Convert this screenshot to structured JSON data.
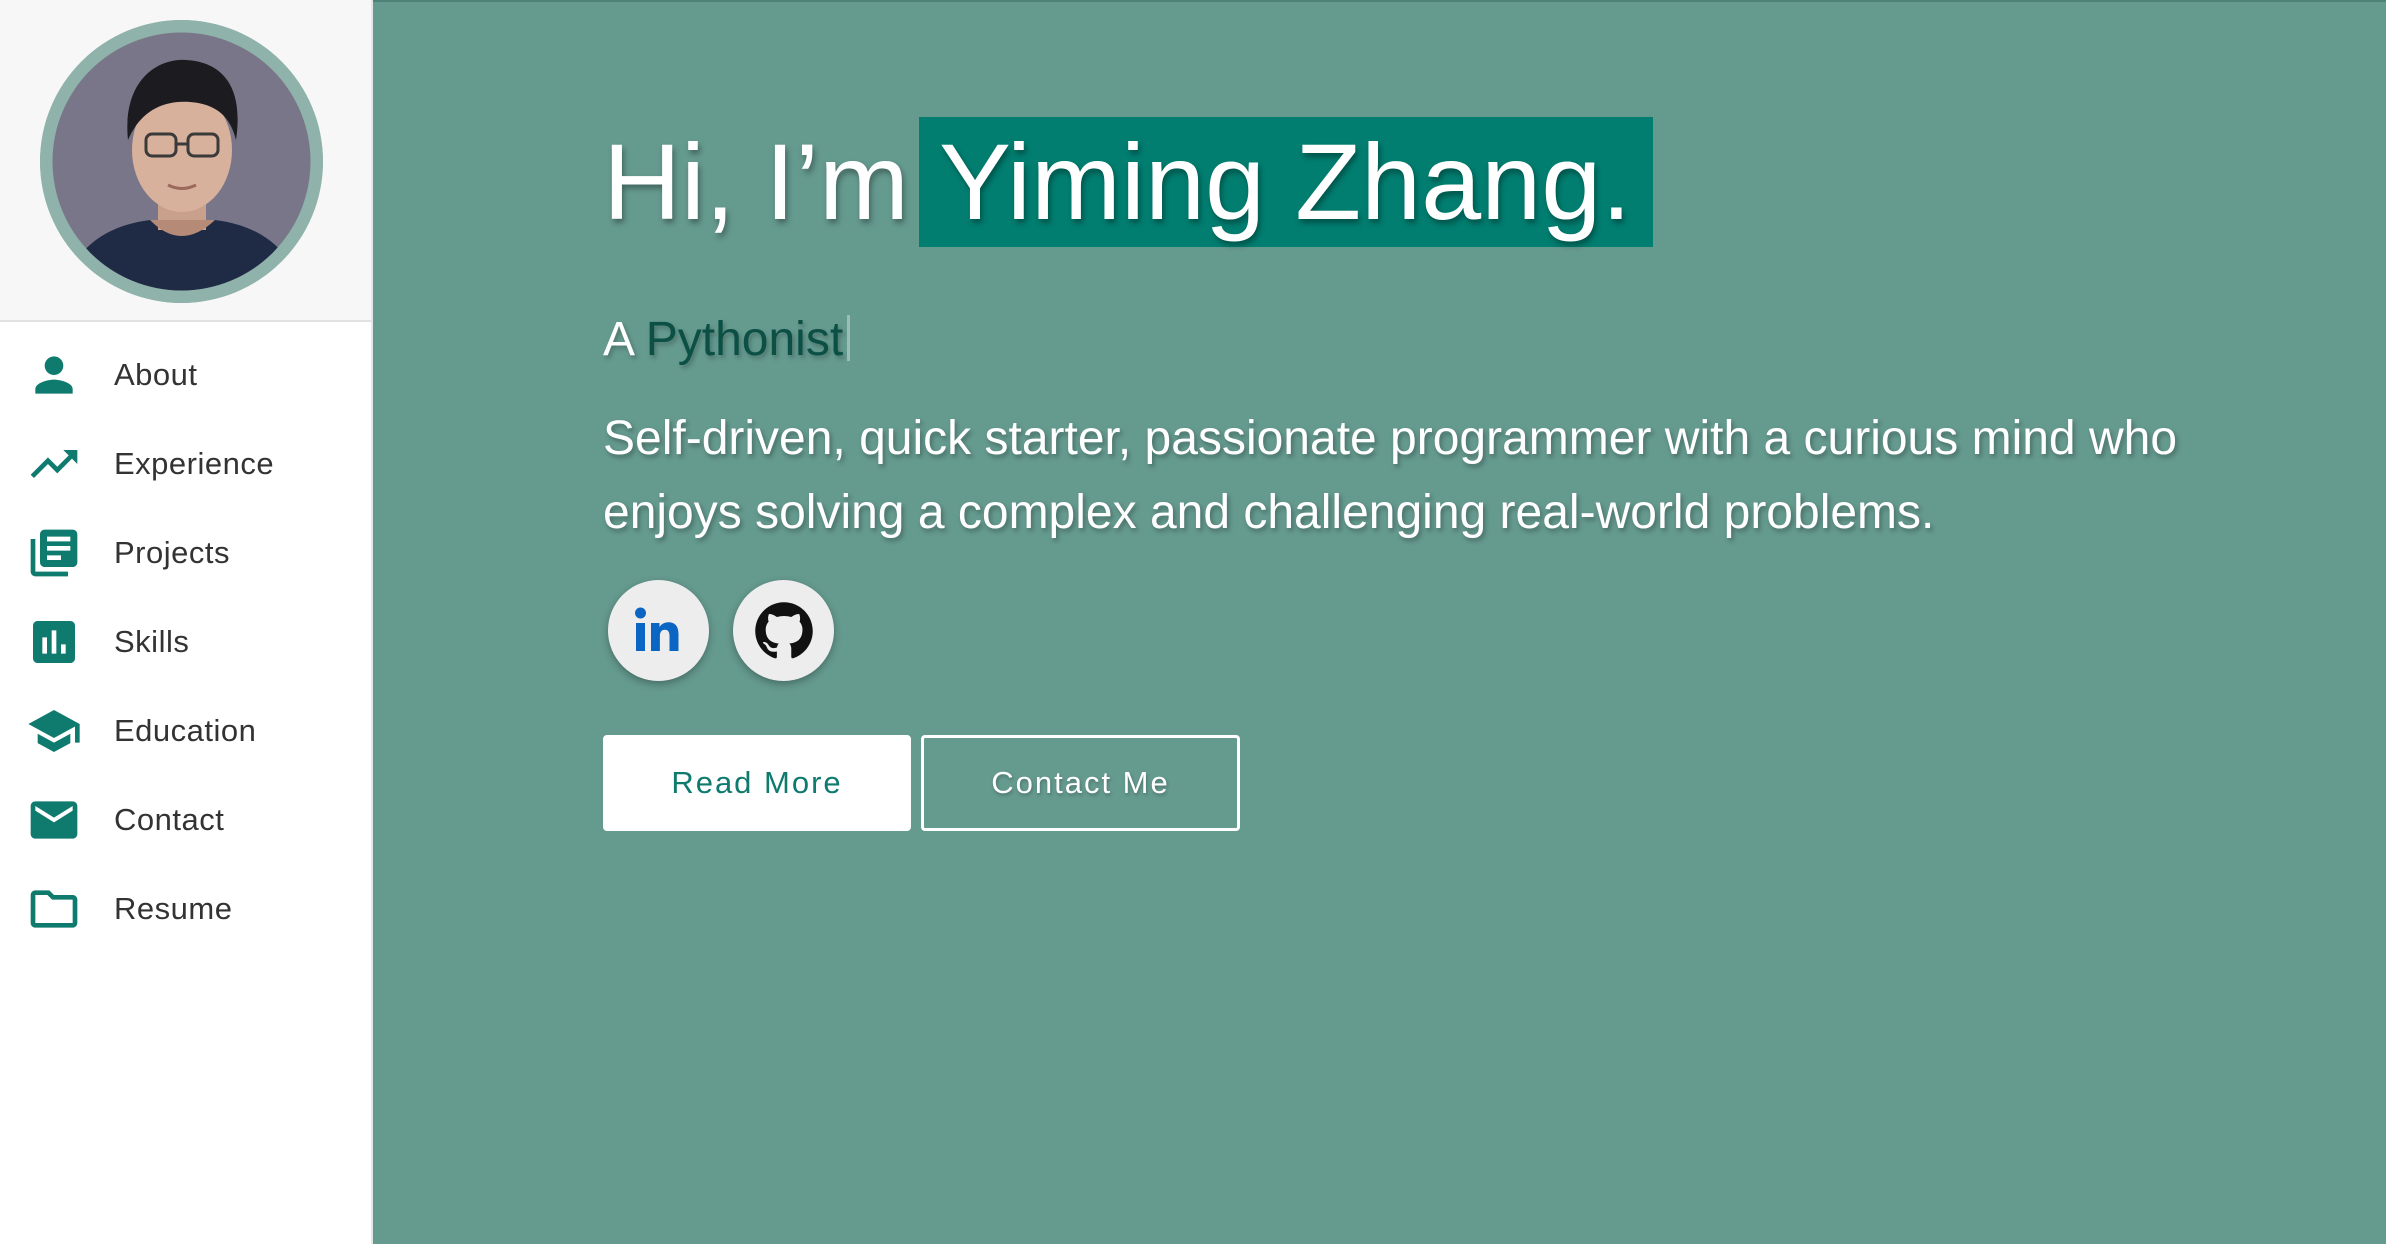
{
  "colors": {
    "accent": "#0f7a6e",
    "hero_background": "#659a8f",
    "name_highlight": "#017e70",
    "sidebar_background": "#ffffff",
    "linkedin_blue": "#0a66c2"
  },
  "sidebar": {
    "avatar_alt": "Profile photo",
    "items": [
      {
        "label": "About",
        "icon": "person-icon"
      },
      {
        "label": "Experience",
        "icon": "trending-up-icon"
      },
      {
        "label": "Projects",
        "icon": "library-books-icon"
      },
      {
        "label": "Skills",
        "icon": "bar-chart-icon"
      },
      {
        "label": "Education",
        "icon": "graduation-cap-icon"
      },
      {
        "label": "Contact",
        "icon": "mail-icon"
      },
      {
        "label": "Resume",
        "icon": "folder-icon"
      }
    ]
  },
  "hero": {
    "greeting": "Hi, I’m",
    "name": "Yiming Zhang.",
    "subtitle_prefix": "A",
    "subtitle_typed": "Pythonist",
    "description": "Self-driven, quick starter, passionate programmer with a curious mind who enjoys solving a complex and challenging real-world problems.",
    "social": [
      {
        "label": "in",
        "icon": "linkedin-icon"
      },
      {
        "icon": "github-icon"
      }
    ],
    "buttons": {
      "read_more": "Read More",
      "contact_me": "Contact Me"
    }
  }
}
